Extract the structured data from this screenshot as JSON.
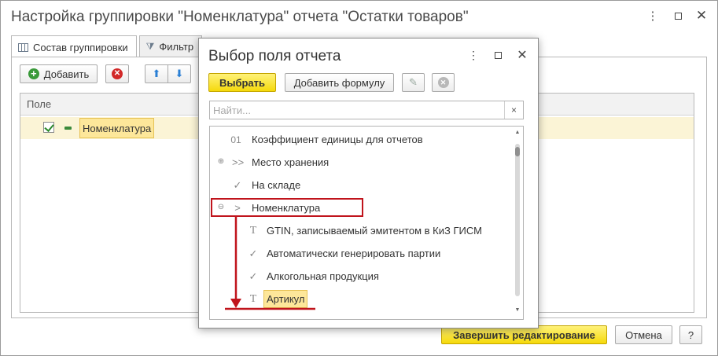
{
  "outer": {
    "title": "Настройка группировки \"Номенклатура\" отчета \"Остатки товаров\"",
    "controls": [
      "more-icon",
      "maximize-icon",
      "close-icon"
    ],
    "tabs": [
      {
        "label": "Состав группировки",
        "icon": "table-icon",
        "active": true
      },
      {
        "label": "Фильтр",
        "icon": "filter-icon",
        "active": false
      }
    ],
    "toolbar": {
      "add_label": "Добавить"
    },
    "grid": {
      "column": "Поле",
      "rows": [
        {
          "checked": true,
          "label": "Номенклатура"
        }
      ]
    },
    "footer": {
      "finish_label": "Завершить редактирование",
      "cancel_label": "Отмена",
      "help_label": "?"
    }
  },
  "dialog": {
    "title": "Выбор поля отчета",
    "select_label": "Выбрать",
    "add_formula_label": "Добавить формулу",
    "search_placeholder": "Найти...",
    "clear_label": "×",
    "items": [
      {
        "icon": "01",
        "label": "Коэффициент единицы для отчетов",
        "expander": "",
        "level": 0
      },
      {
        "icon": ">>",
        "label": "Место хранения",
        "expander": "⊕",
        "level": 0
      },
      {
        "icon": "✓",
        "label": "На складе",
        "expander": "",
        "level": 0
      },
      {
        "icon": ">",
        "label": "Номенклатура",
        "expander": "⊖",
        "level": 0
      },
      {
        "icon": "T",
        "label": "GTIN, записываемый эмитентом в КиЗ ГИСМ",
        "expander": "",
        "level": 1
      },
      {
        "icon": "✓",
        "label": "Автоматически генерировать партии",
        "expander": "",
        "level": 1
      },
      {
        "icon": "✓",
        "label": "Алкогольная продукция",
        "expander": "",
        "level": 1
      },
      {
        "icon": "T",
        "label": "Артикул",
        "expander": "",
        "level": 1,
        "selected": true
      }
    ]
  },
  "colors": {
    "accent_yellow": "#f5d90b",
    "selection": "#fde79a",
    "annotation_red": "#c0141c"
  }
}
